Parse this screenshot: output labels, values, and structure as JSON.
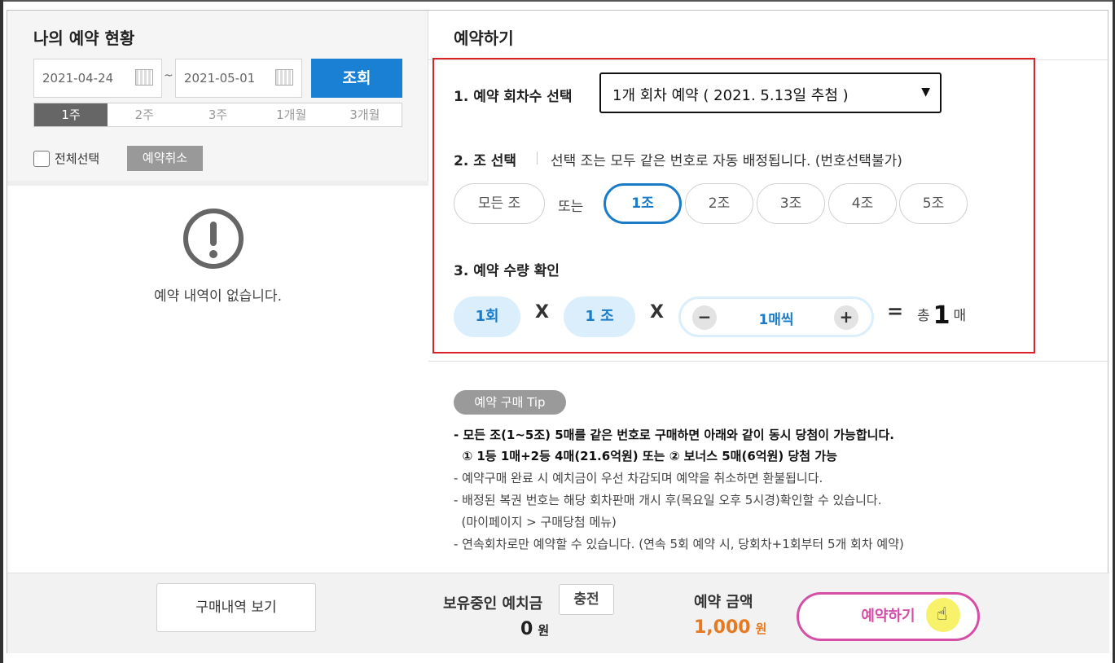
{
  "left": {
    "title": "나의 예약 현황",
    "date_from": "2021-04-24",
    "date_to": "2021-05-01",
    "tilde": "~",
    "search_label": "조회",
    "periods": [
      "1주",
      "2주",
      "3주",
      "1개월",
      "3개월"
    ],
    "select_all_label": "전체선택",
    "cancel_label": "예약취소",
    "empty_message": "예약 내역이 없습니다."
  },
  "right": {
    "title": "예약하기",
    "step1": {
      "label": "1. 예약 회차수 선택",
      "selected": "1개 회차 예약 ( 2021. 5.13일 추첨 )",
      "arrow": "▼"
    },
    "step2": {
      "label": "2. 조 선택",
      "note": "선택 조는 모두 같은 번호로 자동 배정됩니다. (번호선택불가)",
      "all_label": "모든 조",
      "or_label": "또는",
      "groups": [
        "1조",
        "2조",
        "3조",
        "4조",
        "5조"
      ],
      "active_group": "1조"
    },
    "step3": {
      "label": "3. 예약 수량 확인",
      "rounds": "1회",
      "groups": "1 조",
      "times": "X",
      "minus": "−",
      "plus": "+",
      "per": "1매씩",
      "equals": "=",
      "total_prefix": "총",
      "total_value": "1",
      "total_suffix": "매"
    },
    "tip": {
      "badge": "예약 구매 Tip",
      "lines": [
        "- 모든 조(1~5조) 5매를 같은 번호로 구매하면 아래와 같이 동시 당첨이 가능합니다.",
        "  ① 1등 1매+2등 4매(21.6억원) 또는 ② 보너스 5매(6억원) 당첨 가능",
        "- 예약구매 완료 시 예치금이 우선 차감되며 예약을 취소하면 환불됩니다.",
        "- 배정된 복권 번호는 해당 회차판매 개시 후(목요일 오후 5시경)확인할 수 있습니다.",
        "  (마이페이지 > 구매당첨 메뉴)",
        "- 연속회차로만 예약할 수 있습니다. (연속 5회 예약 시, 당회차+1회부터 5개 회차 예약)"
      ]
    }
  },
  "bottom": {
    "history_label": "구매내역 보기",
    "deposit_label": "보유중인 예치금",
    "charge_label": "충전",
    "deposit_value": "0",
    "won": "원",
    "amount_label": "예약 금액",
    "amount_value": "1,000",
    "reserve_label": "예약하기"
  },
  "colors": {
    "primary_blue": "#1a80d4",
    "highlight_red": "#d8232a",
    "reserve_pink": "#d44fa5",
    "amount_orange": "#e57a22"
  }
}
